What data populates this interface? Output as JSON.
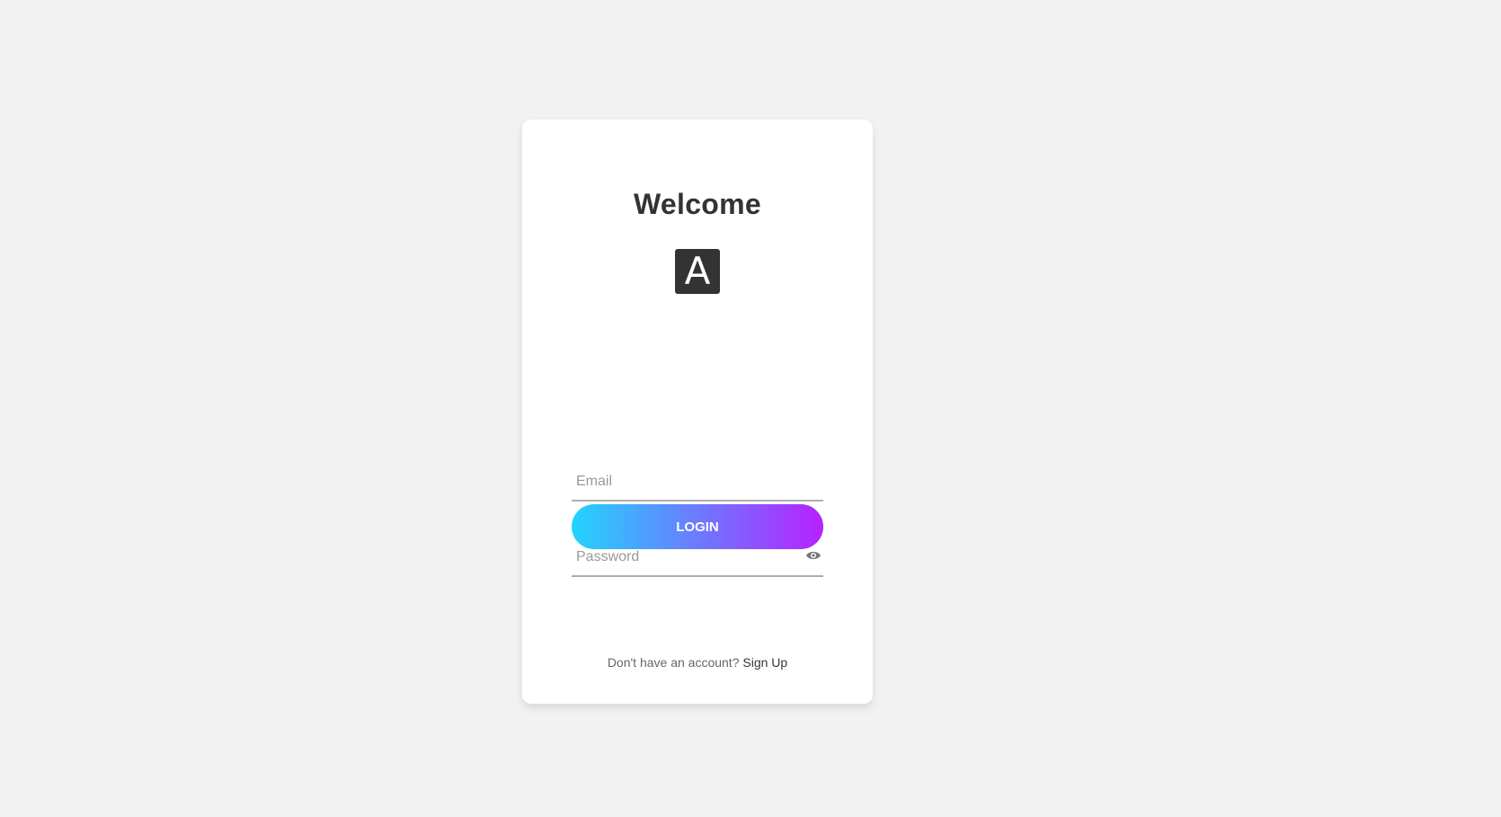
{
  "login": {
    "title": "Welcome",
    "logo_letter": "A",
    "email_placeholder": "Email",
    "password_placeholder": "Password",
    "login_label": "LOGIN",
    "signup_prompt": "Don't have an account?",
    "signup_label": "Sign Up"
  },
  "colors": {
    "background": "#f2f2f2",
    "card": "#ffffff",
    "button_gradient_start": "#21d4fd",
    "button_gradient_end": "#b721ff",
    "text_dark": "#333333"
  }
}
